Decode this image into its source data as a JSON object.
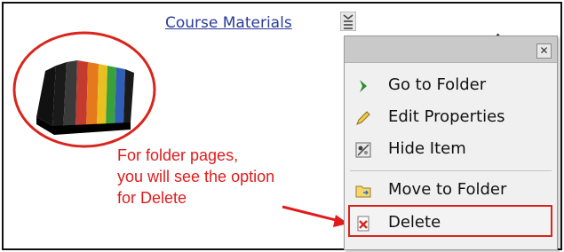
{
  "page": {
    "course_link": "Course Materials"
  },
  "annotation": {
    "lines": [
      "For folder pages,",
      "you will see the option",
      "for Delete"
    ],
    "accent_color": "#e11b1b"
  },
  "context_menu": {
    "close_label": "✕",
    "items": [
      {
        "label": "Go to Folder",
        "icon": "chevron-right-icon"
      },
      {
        "label": "Edit Properties",
        "icon": "pencil-icon"
      },
      {
        "label": "Hide Item",
        "icon": "hide-icon"
      },
      {
        "label": "Move to Folder",
        "icon": "folder-icon"
      },
      {
        "label": "Delete",
        "icon": "delete-icon",
        "highlighted": true
      }
    ]
  }
}
